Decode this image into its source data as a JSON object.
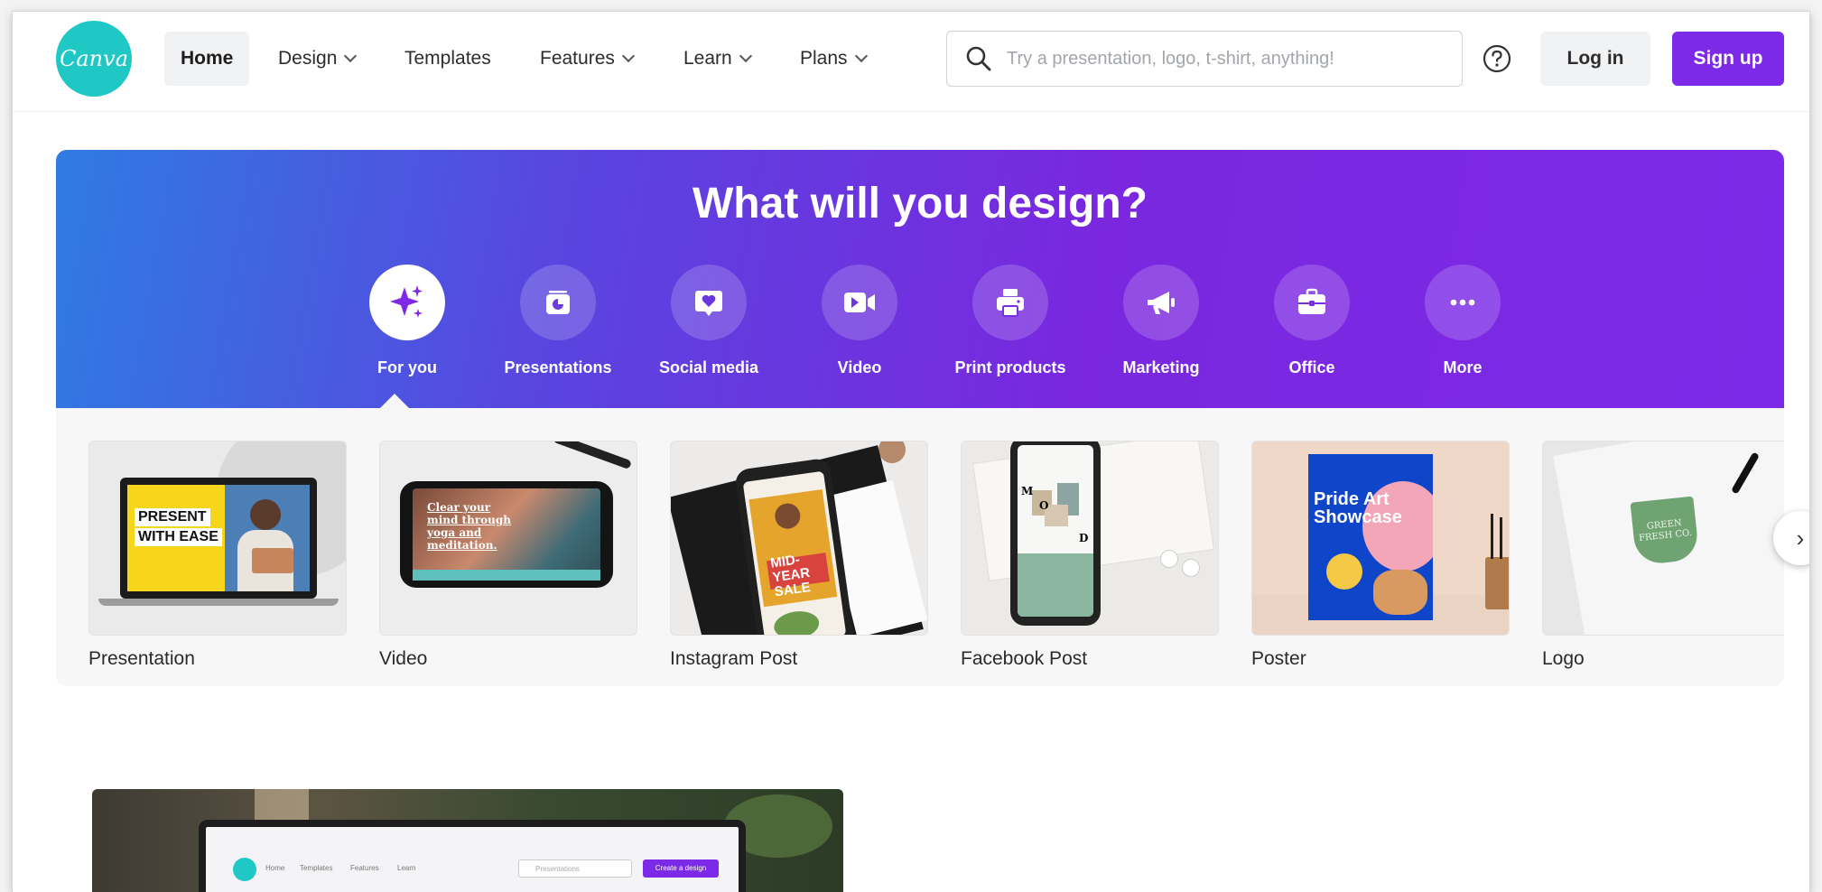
{
  "header": {
    "logo_text": "Canva",
    "nav": [
      {
        "label": "Home",
        "dropdown": false,
        "active": true
      },
      {
        "label": "Design",
        "dropdown": true
      },
      {
        "label": "Templates",
        "dropdown": false
      },
      {
        "label": "Features",
        "dropdown": true
      },
      {
        "label": "Learn",
        "dropdown": true
      },
      {
        "label": "Plans",
        "dropdown": true
      }
    ],
    "search_placeholder": "Try a presentation, logo, t-shirt, anything!",
    "help_icon": "question-circle-icon",
    "login_label": "Log in",
    "signup_label": "Sign up"
  },
  "hero": {
    "title": "What will you design?",
    "categories": [
      {
        "label": "For you",
        "icon": "sparkle-icon"
      },
      {
        "label": "Presentations",
        "icon": "presentation-icon"
      },
      {
        "label": "Social media",
        "icon": "heart-chat-icon"
      },
      {
        "label": "Video",
        "icon": "video-camera-icon"
      },
      {
        "label": "Print products",
        "icon": "printer-icon"
      },
      {
        "label": "Marketing",
        "icon": "megaphone-icon"
      },
      {
        "label": "Office",
        "icon": "briefcase-icon"
      },
      {
        "label": "More",
        "icon": "more-dots-icon"
      }
    ]
  },
  "design_types": [
    {
      "label": "Presentation",
      "thumb_text": [
        "PRESENT",
        "WITH EASE"
      ]
    },
    {
      "label": "Video",
      "thumb_text": [
        "Clear your",
        "mind through",
        "yoga and",
        "meditation."
      ]
    },
    {
      "label": "Instagram Post",
      "thumb_text": [
        "MID-YEAR",
        "SALE"
      ]
    },
    {
      "label": "Facebook Post",
      "thumb_text": [
        "M",
        "O",
        "D"
      ]
    },
    {
      "label": "Poster",
      "thumb_text": [
        "Pride Art",
        "Showcase"
      ]
    },
    {
      "label": "Logo",
      "thumb_text": [
        "GREEN",
        "FRESH CO."
      ]
    }
  ],
  "carousel_next": "›",
  "preview": {
    "nav": [
      "Home",
      "Templates",
      "Features",
      "Learn"
    ],
    "search_text": "Presentations",
    "button_text": "Create a design"
  },
  "colors": {
    "brand_purple": "#7d2ae8",
    "logo_teal": "#1fc8c4",
    "hero_start": "#2f7be2",
    "hero_end": "#7d2ae8"
  }
}
